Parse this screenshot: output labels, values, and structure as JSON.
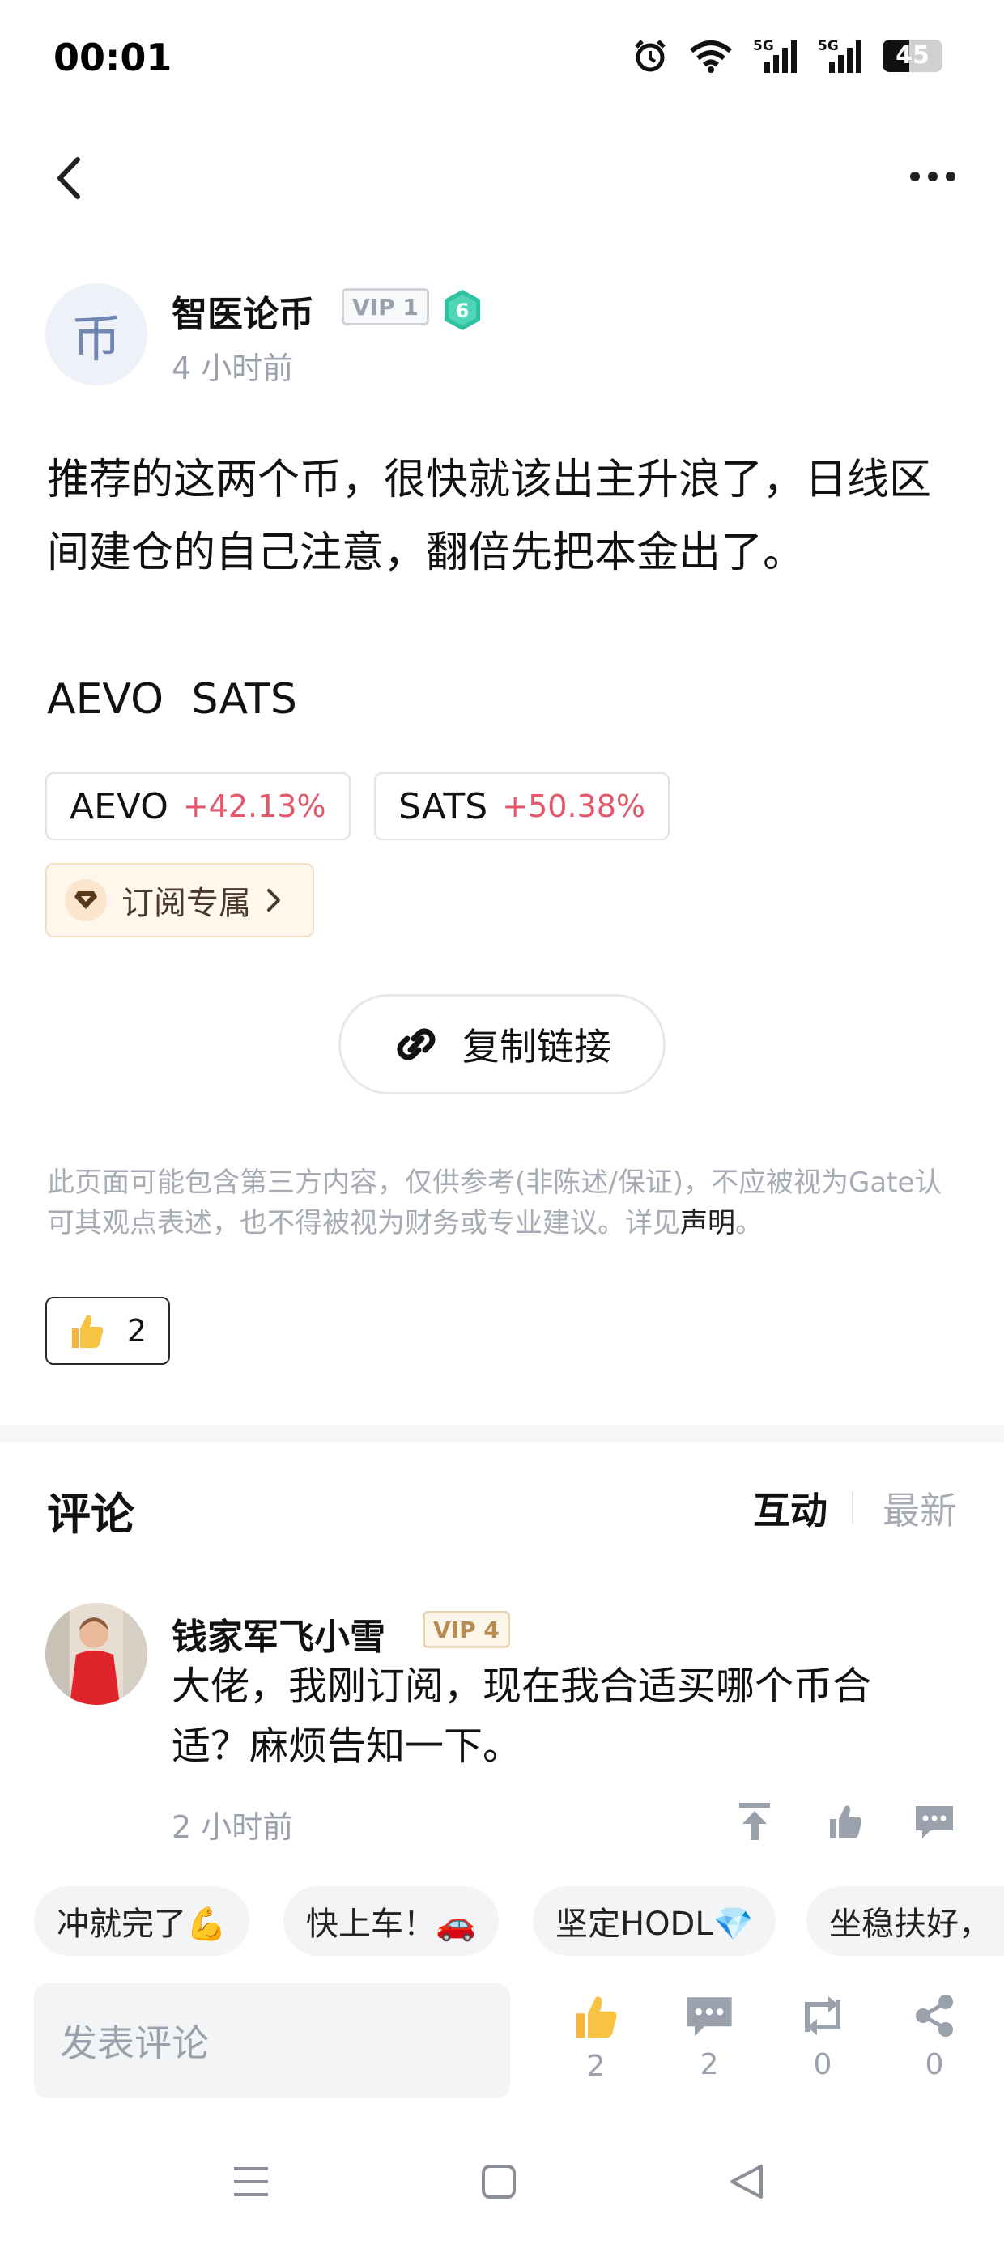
{
  "status_bar": {
    "time": "00:01",
    "battery_level": "45",
    "network_labels": [
      "5G",
      "5G"
    ]
  },
  "author": {
    "avatar_glyph": "币",
    "name": "智医论币",
    "vip_label": "VIP 1",
    "level": "6",
    "time": "4 小时前"
  },
  "post": {
    "text": "推荐的这两个币，很快就该出主升浪了，日线区间建仓的自己注意，翻倍先把本金出了。",
    "tickers_line": "AEVO  SATS",
    "tickers": [
      {
        "symbol": "AEVO",
        "change": "+42.13%"
      },
      {
        "symbol": "SATS",
        "change": "+50.38%"
      }
    ],
    "subscribe_label": "订阅专属",
    "copy_link_label": "复制链接",
    "disclaimer_text": "此页面可能包含第三方内容，仅供参考(非陈述/保证)，不应被视为Gate认可其观点表述，也不得被视为财务或专业建议。详见",
    "disclaimer_link": "声明",
    "disclaimer_end": "。",
    "like_count": "2"
  },
  "comments": {
    "title": "评论",
    "sort_interact": "互动",
    "sort_latest": "最新",
    "items": [
      {
        "name": "钱家军飞小雪",
        "vip_label": "VIP 4",
        "text": "大佬，我刚订阅，现在我合适买哪个币合适？麻烦告知一下。",
        "time": "2 小时前"
      }
    ]
  },
  "quick_replies": [
    "冲就完了💪",
    "快上车！🚗",
    "坚定HODL💎",
    "坐稳扶好，"
  ],
  "bottom_bar": {
    "input_placeholder": "发表评论",
    "like_count": "2",
    "comment_count": "2",
    "repost_count": "0",
    "share_count": "0"
  },
  "colors": {
    "positive_change": "#e2586a",
    "level_badge": "#2fc2a0",
    "muted_text": "#9aa1ac"
  }
}
